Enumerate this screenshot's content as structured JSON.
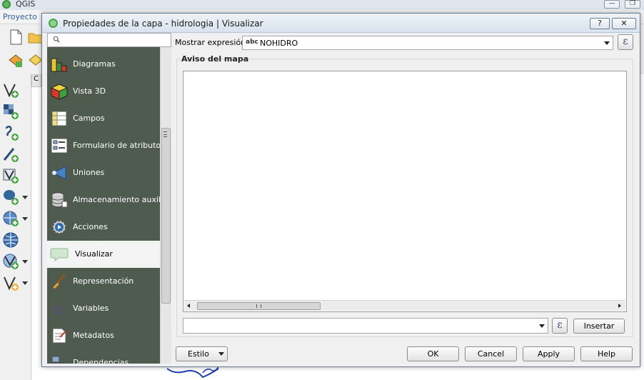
{
  "main_window": {
    "title": "QGIS",
    "menu_item": "Proyecto",
    "panel_tab": "C"
  },
  "dialog": {
    "title": "Propiedades de la capa - hidrologia | Visualizar",
    "help_label": "?",
    "close_label": "✕"
  },
  "search": {
    "placeholder": ""
  },
  "nav": {
    "items": [
      {
        "label": "Diagramas",
        "icon": "diagrams-icon"
      },
      {
        "label": "Vista 3D",
        "icon": "cube-3d-icon"
      },
      {
        "label": "Campos",
        "icon": "fields-icon"
      },
      {
        "label": "Formulario de atributos",
        "icon": "attribute-form-icon"
      },
      {
        "label": "Uniones",
        "icon": "joins-icon"
      },
      {
        "label": "Almacenamiento auxiliar",
        "icon": "auxiliary-storage-icon"
      },
      {
        "label": "Acciones",
        "icon": "actions-icon"
      },
      {
        "label": "Visualizar",
        "icon": "display-bubble-icon"
      },
      {
        "label": "Representación",
        "icon": "rendering-brush-icon"
      },
      {
        "label": "Variables",
        "icon": "variables-epsilon-icon"
      },
      {
        "label": "Metadatos",
        "icon": "metadata-icon"
      },
      {
        "label": "Dependencias",
        "icon": "dependencies-icon"
      }
    ],
    "selected": "Visualizar"
  },
  "display": {
    "expression_label": "Mostrar expresión",
    "expression_type": "abc",
    "expression_value": "NOHIDRO",
    "expression_button": "ε",
    "group_title": "Aviso del mapa",
    "map_tip_text": "",
    "insert_field_value": "",
    "insert_expression_button": "ε",
    "insert_button": "Insertar"
  },
  "footer": {
    "style_label": "Estilo",
    "ok_label": "OK",
    "cancel_label": "Cancel",
    "apply_label": "Apply",
    "help_label": "Help"
  },
  "colors": {
    "nav_background": "#505b50",
    "selected_item": "#f4f4f4",
    "map_line": "#1f3fb5"
  }
}
